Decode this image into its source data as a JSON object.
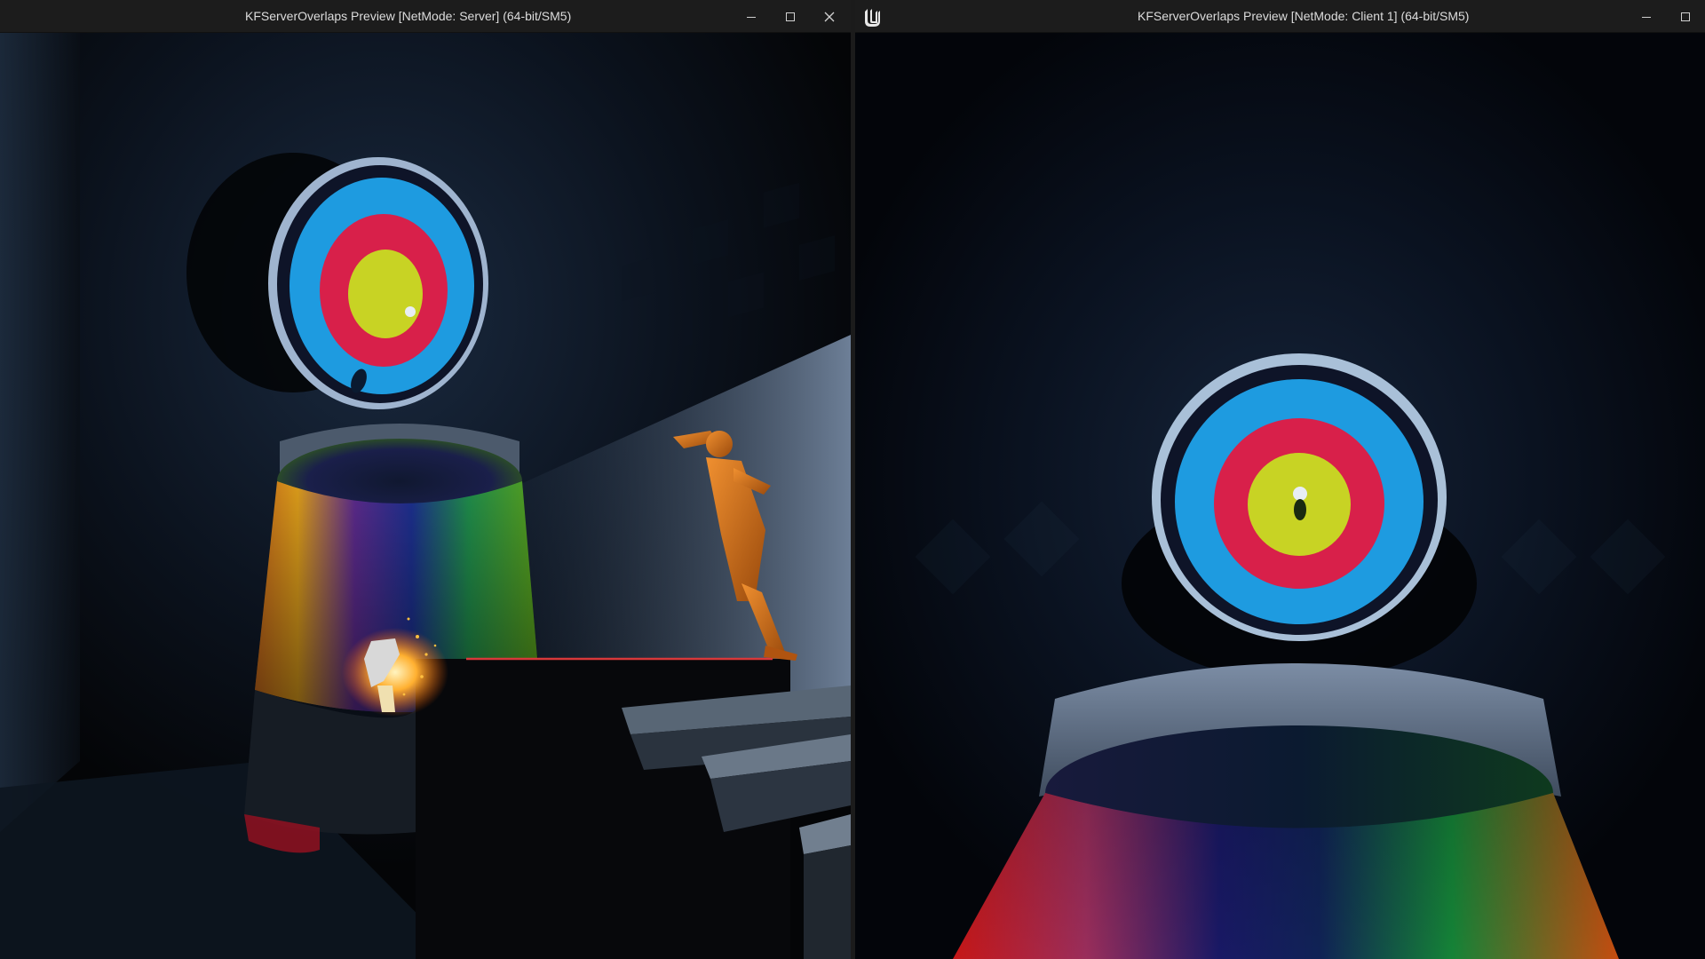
{
  "windows": {
    "server": {
      "title": "KFServerOverlaps Preview [NetMode: Server]  (64-bit/SM5)"
    },
    "client": {
      "title": "KFServerOverlaps Preview [NetMode: Client 1]  (64-bit/SM5)"
    }
  },
  "icons": {
    "minimize": "minimize-icon",
    "maximize": "maximize-icon",
    "close": "close-icon",
    "engine_logo": "unreal-engine-logo-icon"
  },
  "colors": {
    "titlebar": "#1c1c1c",
    "target_outer": "#1e9be0",
    "target_ring_red": "#d8204a",
    "target_center": "#c8d324",
    "character": "#d46a14"
  }
}
